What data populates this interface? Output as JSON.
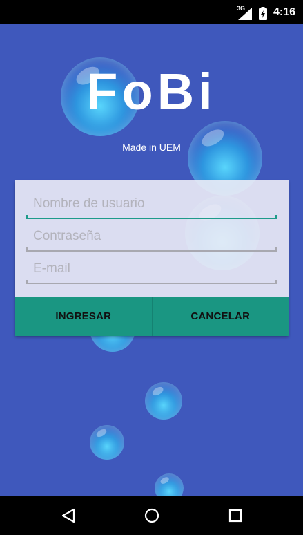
{
  "status_bar": {
    "network": "3G",
    "time": "4:16",
    "icons": [
      "signal-icon",
      "battery-icon"
    ]
  },
  "app": {
    "logo": "FoBi",
    "subtitle": "Made in UEM",
    "background_color": "#3f58bc",
    "accent_color": "#1a9682"
  },
  "form": {
    "username_placeholder": "Nombre de usuario",
    "password_placeholder": "Contraseña",
    "email_placeholder": "E-mail",
    "username_value": "",
    "password_value": "",
    "email_value": ""
  },
  "buttons": {
    "login_label": "INGRESAR",
    "cancel_label": "CANCELAR"
  },
  "nav_bar": {
    "icons": [
      "back-icon",
      "home-icon",
      "recents-icon"
    ]
  }
}
